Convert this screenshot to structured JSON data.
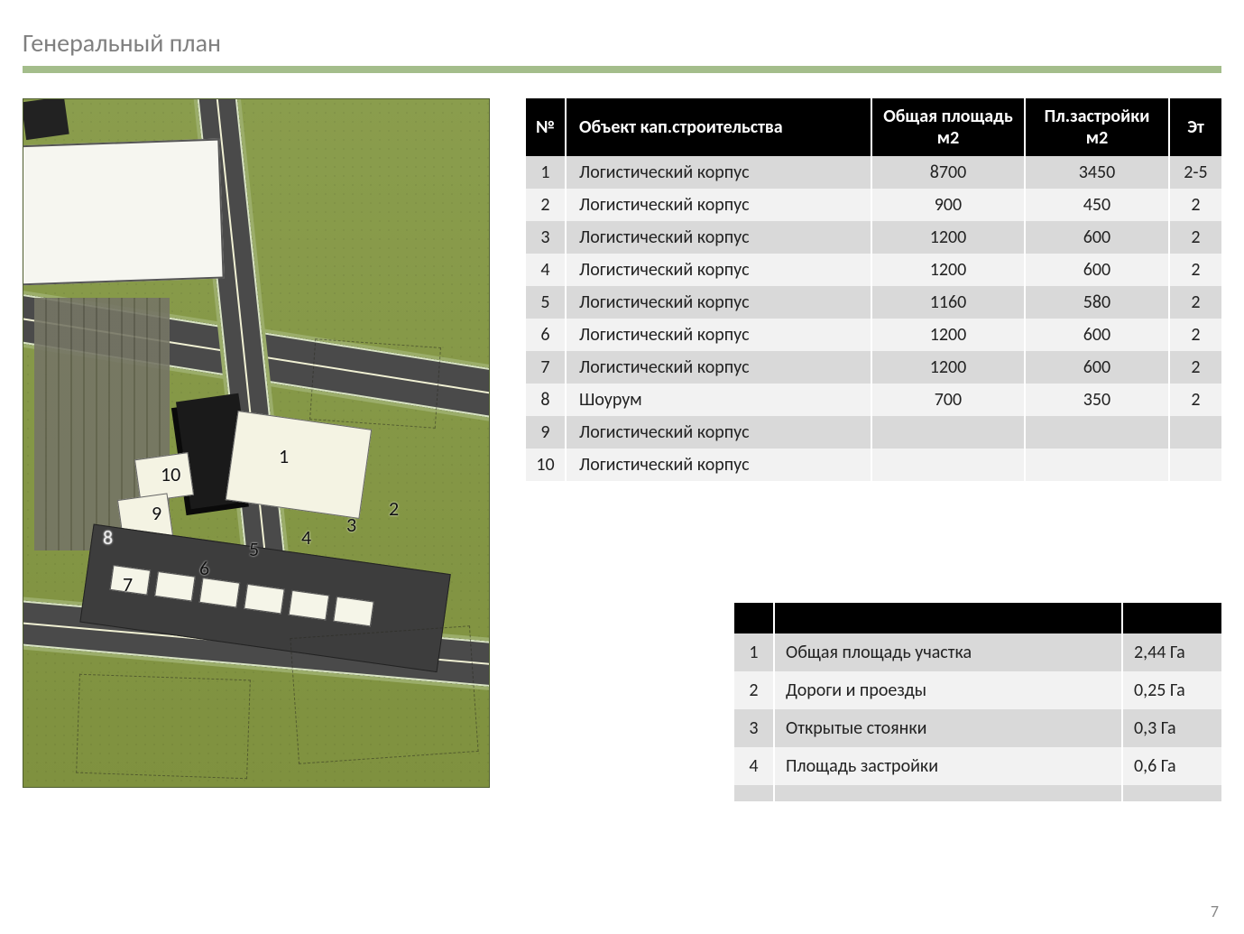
{
  "title": "Генеральный план",
  "page_number": "7",
  "map": {
    "labels": [
      "1",
      "2",
      "3",
      "4",
      "5",
      "6",
      "7",
      "8",
      "9",
      "10"
    ]
  },
  "main_table": {
    "headers": [
      "№",
      "Объект кап.строительства",
      "Общая площадь м2",
      "Пл.застройки м2",
      "Эт"
    ],
    "rows": [
      {
        "n": "1",
        "name": "Логистический корпус",
        "area": "8700",
        "footprint": "3450",
        "floors": "2-5"
      },
      {
        "n": "2",
        "name": "Логистический корпус",
        "area": "900",
        "footprint": "450",
        "floors": "2"
      },
      {
        "n": "3",
        "name": "Логистический корпус",
        "area": "1200",
        "footprint": "600",
        "floors": "2"
      },
      {
        "n": "4",
        "name": "Логистический корпус",
        "area": "1200",
        "footprint": "600",
        "floors": "2"
      },
      {
        "n": "5",
        "name": "Логистический корпус",
        "area": "1160",
        "footprint": "580",
        "floors": "2"
      },
      {
        "n": "6",
        "name": "Логистический корпус",
        "area": "1200",
        "footprint": "600",
        "floors": "2"
      },
      {
        "n": "7",
        "name": "Логистический корпус",
        "area": "1200",
        "footprint": "600",
        "floors": "2"
      },
      {
        "n": "8",
        "name": "Шоурум",
        "area": "700",
        "footprint": "350",
        "floors": "2"
      },
      {
        "n": "9",
        "name": "Логистический корпус",
        "area": "",
        "footprint": "",
        "floors": ""
      },
      {
        "n": "10",
        "name": "Логистический корпус",
        "area": "",
        "footprint": "",
        "floors": ""
      }
    ]
  },
  "site_table": {
    "headers": [
      "",
      "",
      ""
    ],
    "rows": [
      {
        "n": "1",
        "name": "Общая площадь участка",
        "value": "2,44 Га"
      },
      {
        "n": "2",
        "name": "Дороги и проезды",
        "value": "0,25 Га"
      },
      {
        "n": "3",
        "name": "Открытые стоянки",
        "value": "0,3 Га"
      },
      {
        "n": "4",
        "name": "Площадь застройки",
        "value": "0,6 Га"
      },
      {
        "n": "",
        "name": "",
        "value": ""
      }
    ]
  }
}
